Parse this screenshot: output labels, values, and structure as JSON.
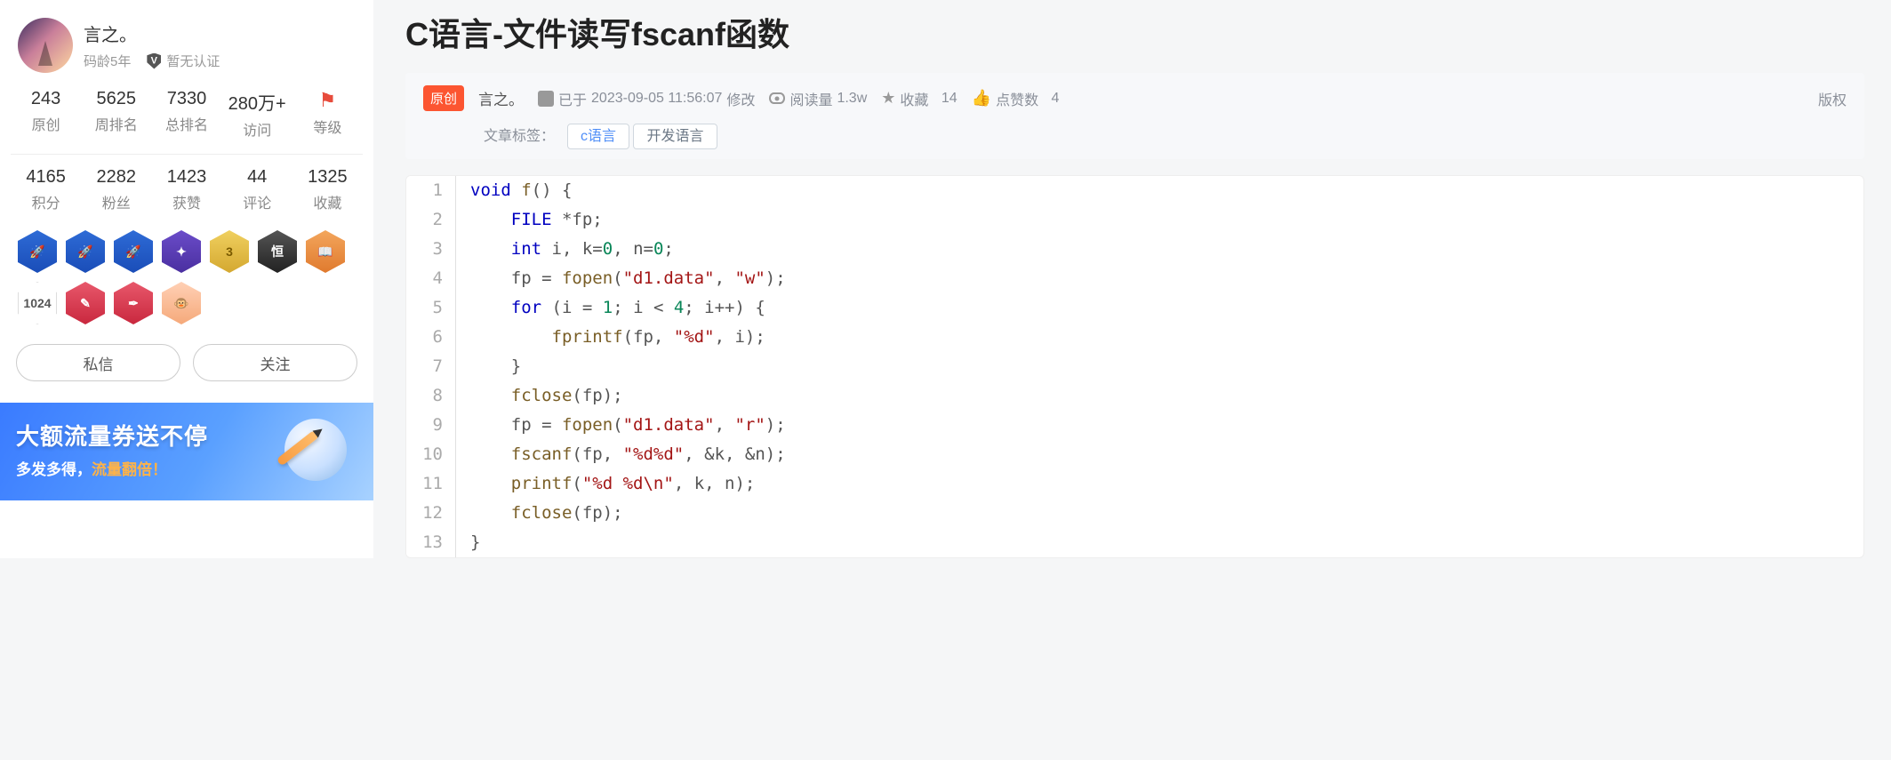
{
  "sidebar": {
    "name": "言之。",
    "age_label": "码龄5年",
    "cert_label": "暂无认证",
    "stats1": [
      {
        "val": "243",
        "label": "原创"
      },
      {
        "val": "5625",
        "label": "周排名"
      },
      {
        "val": "7330",
        "label": "总排名"
      },
      {
        "val": "280万+",
        "label": "访问"
      },
      {
        "val": "",
        "label": "等级"
      }
    ],
    "stats2": [
      {
        "val": "4165",
        "label": "积分"
      },
      {
        "val": "2282",
        "label": "粉丝"
      },
      {
        "val": "1423",
        "label": "获赞"
      },
      {
        "val": "44",
        "label": "评论"
      },
      {
        "val": "1325",
        "label": "收藏"
      }
    ],
    "btn_message": "私信",
    "btn_follow": "关注",
    "promo_title": "大额流量券送不停",
    "promo_sub_a": "多发多得，",
    "promo_sub_b": "流量翻倍！"
  },
  "article": {
    "title": "C语言-文件读写fscanf函数",
    "orig_tag": "原创",
    "author": "言之。",
    "time_prefix": "已于 ",
    "time": "2023-09-05 11:56:07",
    "time_suffix": " 修改",
    "views_label": "阅读量",
    "views": "1.3w",
    "fav_label": "收藏",
    "fav": "14",
    "like_label": "点赞数",
    "like": "4",
    "copyright": "版权",
    "tags_label": "文章标签：",
    "tags": [
      "c语言",
      "开发语言"
    ]
  },
  "code": [
    [
      {
        "t": "void ",
        "c": "kw"
      },
      {
        "t": "f",
        "c": "fn"
      },
      {
        "t": "() {",
        "c": "pun"
      }
    ],
    [
      {
        "t": "    FILE ",
        "c": "kw"
      },
      {
        "t": "*fp;",
        "c": "pun"
      }
    ],
    [
      {
        "t": "    ",
        "c": ""
      },
      {
        "t": "int ",
        "c": "kw"
      },
      {
        "t": "i, k=",
        "c": "pun"
      },
      {
        "t": "0",
        "c": "num"
      },
      {
        "t": ", n=",
        "c": "pun"
      },
      {
        "t": "0",
        "c": "num"
      },
      {
        "t": ";",
        "c": "pun"
      }
    ],
    [
      {
        "t": "    fp = ",
        "c": "pun"
      },
      {
        "t": "fopen",
        "c": "fn"
      },
      {
        "t": "(",
        "c": "pun"
      },
      {
        "t": "\"d1.data\"",
        "c": "str"
      },
      {
        "t": ", ",
        "c": "pun"
      },
      {
        "t": "\"w\"",
        "c": "str"
      },
      {
        "t": ");",
        "c": "pun"
      }
    ],
    [
      {
        "t": "    ",
        "c": ""
      },
      {
        "t": "for ",
        "c": "kw"
      },
      {
        "t": "(i = ",
        "c": "pun"
      },
      {
        "t": "1",
        "c": "num"
      },
      {
        "t": "; i < ",
        "c": "pun"
      },
      {
        "t": "4",
        "c": "num"
      },
      {
        "t": "; i++) {",
        "c": "pun"
      }
    ],
    [
      {
        "t": "        ",
        "c": ""
      },
      {
        "t": "fprintf",
        "c": "fn"
      },
      {
        "t": "(fp, ",
        "c": "pun"
      },
      {
        "t": "\"%d\"",
        "c": "str"
      },
      {
        "t": ", i);",
        "c": "pun"
      }
    ],
    [
      {
        "t": "    }",
        "c": "pun"
      }
    ],
    [
      {
        "t": "    ",
        "c": ""
      },
      {
        "t": "fclose",
        "c": "fn"
      },
      {
        "t": "(fp);",
        "c": "pun"
      }
    ],
    [
      {
        "t": "    fp = ",
        "c": "pun"
      },
      {
        "t": "fopen",
        "c": "fn"
      },
      {
        "t": "(",
        "c": "pun"
      },
      {
        "t": "\"d1.data\"",
        "c": "str"
      },
      {
        "t": ", ",
        "c": "pun"
      },
      {
        "t": "\"r\"",
        "c": "str"
      },
      {
        "t": ");",
        "c": "pun"
      }
    ],
    [
      {
        "t": "    ",
        "c": ""
      },
      {
        "t": "fscanf",
        "c": "fn"
      },
      {
        "t": "(fp, ",
        "c": "pun"
      },
      {
        "t": "\"%d%d\"",
        "c": "str"
      },
      {
        "t": ", &k, &n);",
        "c": "pun"
      }
    ],
    [
      {
        "t": "    ",
        "c": ""
      },
      {
        "t": "printf",
        "c": "fn"
      },
      {
        "t": "(",
        "c": "pun"
      },
      {
        "t": "\"%d %d\\n\"",
        "c": "str"
      },
      {
        "t": ", k, n);",
        "c": "pun"
      }
    ],
    [
      {
        "t": "    ",
        "c": ""
      },
      {
        "t": "fclose",
        "c": "fn"
      },
      {
        "t": "(fp);",
        "c": "pun"
      }
    ],
    [
      {
        "t": "}",
        "c": "pun"
      }
    ]
  ]
}
